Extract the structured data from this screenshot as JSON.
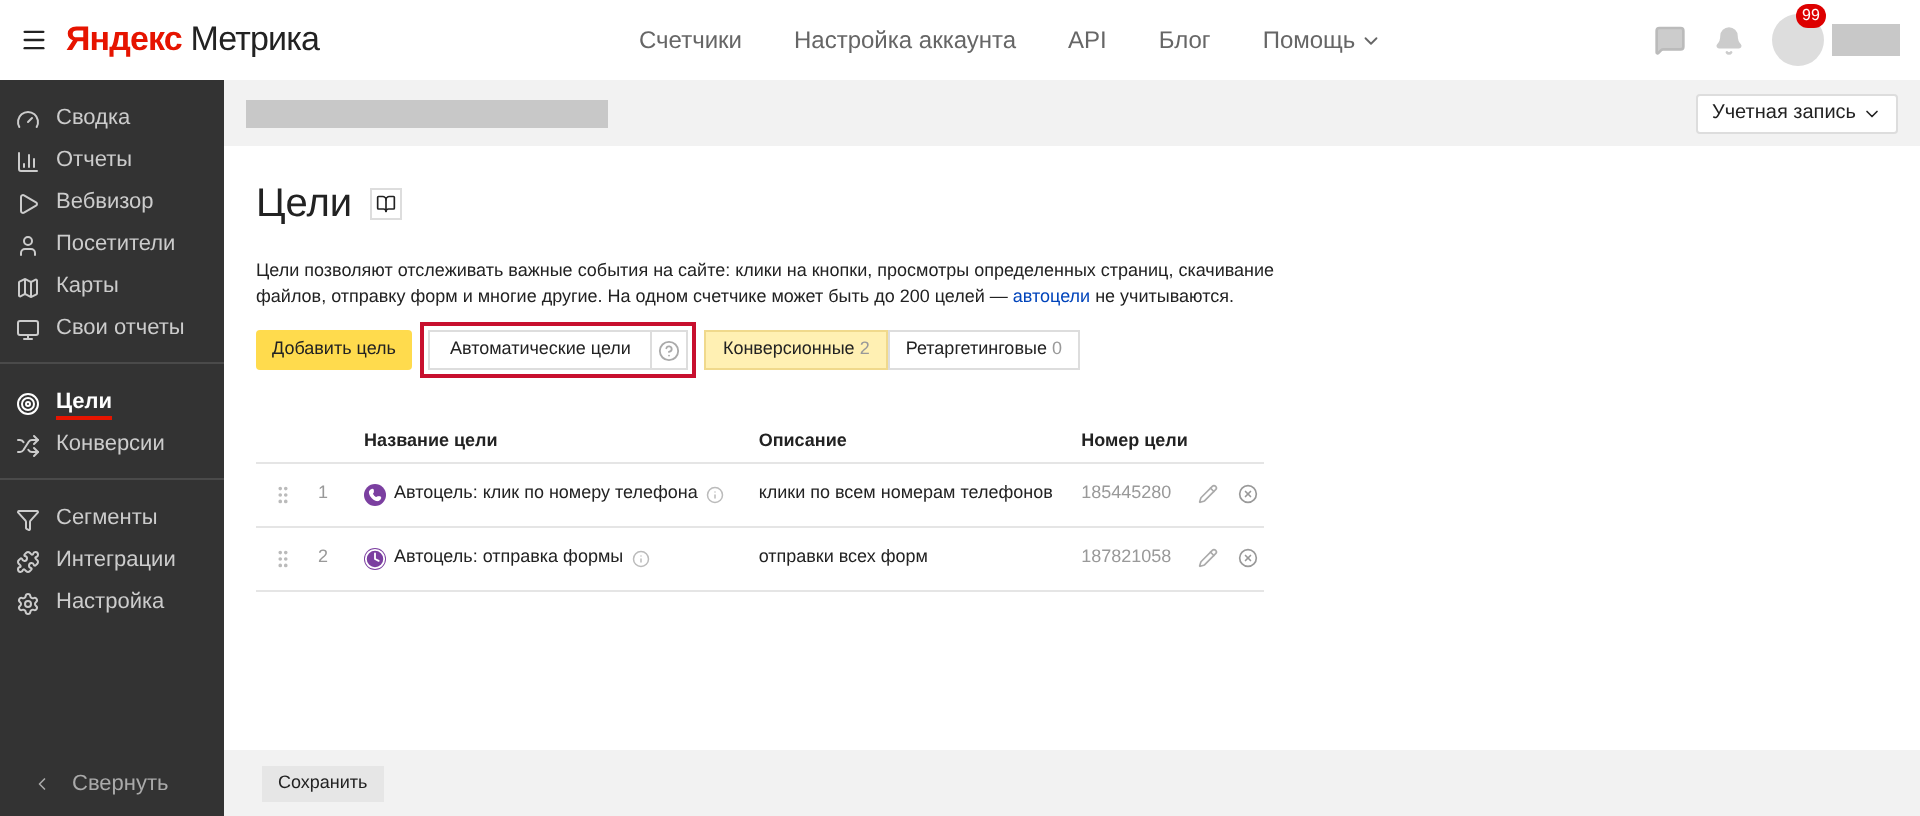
{
  "header": {
    "logo_brand": "Яндекс",
    "logo_product": "Метрика",
    "nav": [
      {
        "label": "Счетчики",
        "kind": "link"
      },
      {
        "label": "Настройка аккаунта",
        "kind": "link"
      },
      {
        "label": "API",
        "kind": "link"
      },
      {
        "label": "Блог",
        "kind": "link"
      },
      {
        "label": "Помощь",
        "kind": "dropdown"
      }
    ],
    "badge": "99"
  },
  "sidebar": {
    "groups": [
      [
        {
          "label": "Сводка",
          "selected": false
        },
        {
          "label": "Отчеты",
          "selected": false
        },
        {
          "label": "Вебвизор",
          "selected": false
        },
        {
          "label": "Посетители",
          "selected": false
        },
        {
          "label": "Карты",
          "selected": false
        },
        {
          "label": "Свои отчеты",
          "selected": false
        }
      ],
      [
        {
          "label": "Цели",
          "selected": true
        },
        {
          "label": "Конверсии",
          "selected": false
        }
      ],
      [
        {
          "label": "Сегменты",
          "selected": false
        },
        {
          "label": "Интеграции",
          "selected": false
        },
        {
          "label": "Настройка",
          "selected": false
        }
      ]
    ],
    "collapse": "Свернуть"
  },
  "account_button": "Учетная запись",
  "title": "Цели",
  "description": "Цели позволяют отслеживать важные события на сайте: клики на кнопки, просмотры определенных страниц, скачивание файлов, отправку форм и многие другие. На одном счетчике может быть до 200 целей — ",
  "description_link": "автоцели",
  "description_end": " не учитываются.",
  "add_button": "Добавить цель",
  "auto_goals": {
    "label": "Автоматические цели",
    "highlighted": true
  },
  "tabs": [
    {
      "label": "Конверсионные",
      "count": "2",
      "selected": true
    },
    {
      "label": "Ретаргетинговые",
      "count": "0",
      "selected": false
    }
  ],
  "table": {
    "columns": [
      "Название цели",
      "Описание",
      "Номер цели"
    ],
    "rows": [
      {
        "index": "1",
        "kind": "phone",
        "name": "Автоцель: клик по номеру телефона",
        "description": "клики по всем номерам телефонов",
        "number": "185445280"
      },
      {
        "index": "2",
        "kind": "form",
        "name": "Автоцель: отправка формы",
        "description": "отправки всех форм",
        "number": "187821058"
      }
    ]
  },
  "save_button": "Сохранить"
}
